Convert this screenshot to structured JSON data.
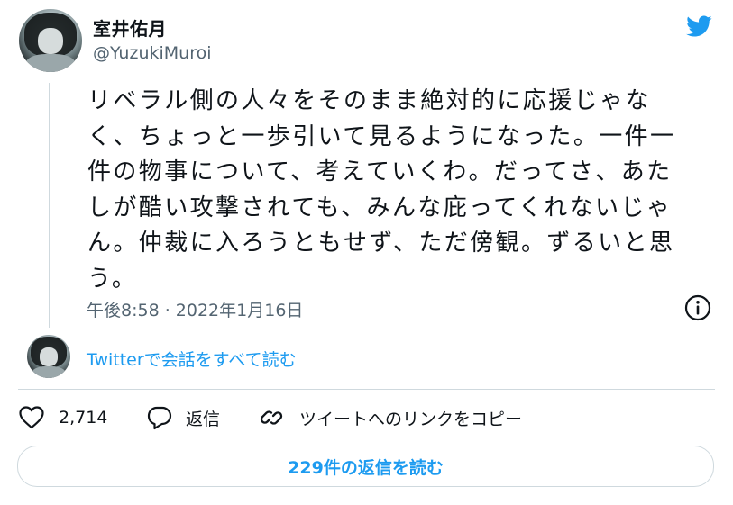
{
  "author": {
    "display_name": "室井佑月",
    "handle": "@YuzukiMuroi"
  },
  "tweet": {
    "text": "リベラル側の人々をそのまま絶対的に応援じゃな\nく、ちょっと一歩引いて見るようになった。一件一\n件の物事について、考えていくわ。だってさ、あた\nしが酷い攻撃されても、みんな庇ってくれないじゃ\nん。仲裁に入ろうともせず、ただ傍観。ずるいと思\nう。",
    "timestamp": "午後8:58 · 2022年1月16日"
  },
  "thread_link": "Twitterで会話をすべて読む",
  "actions": {
    "like_count": "2,714",
    "reply_label": "返信",
    "copy_link_label": "ツイートへのリンクをコピー"
  },
  "replies_button": "229件の返信を読む",
  "colors": {
    "accent": "#1d9bf0",
    "text": "#0f1419",
    "secondary": "#536471",
    "border": "#cfd9de"
  },
  "icons": [
    "twitter-bird-icon",
    "info-icon",
    "heart-icon",
    "reply-bubble-icon",
    "link-icon"
  ]
}
